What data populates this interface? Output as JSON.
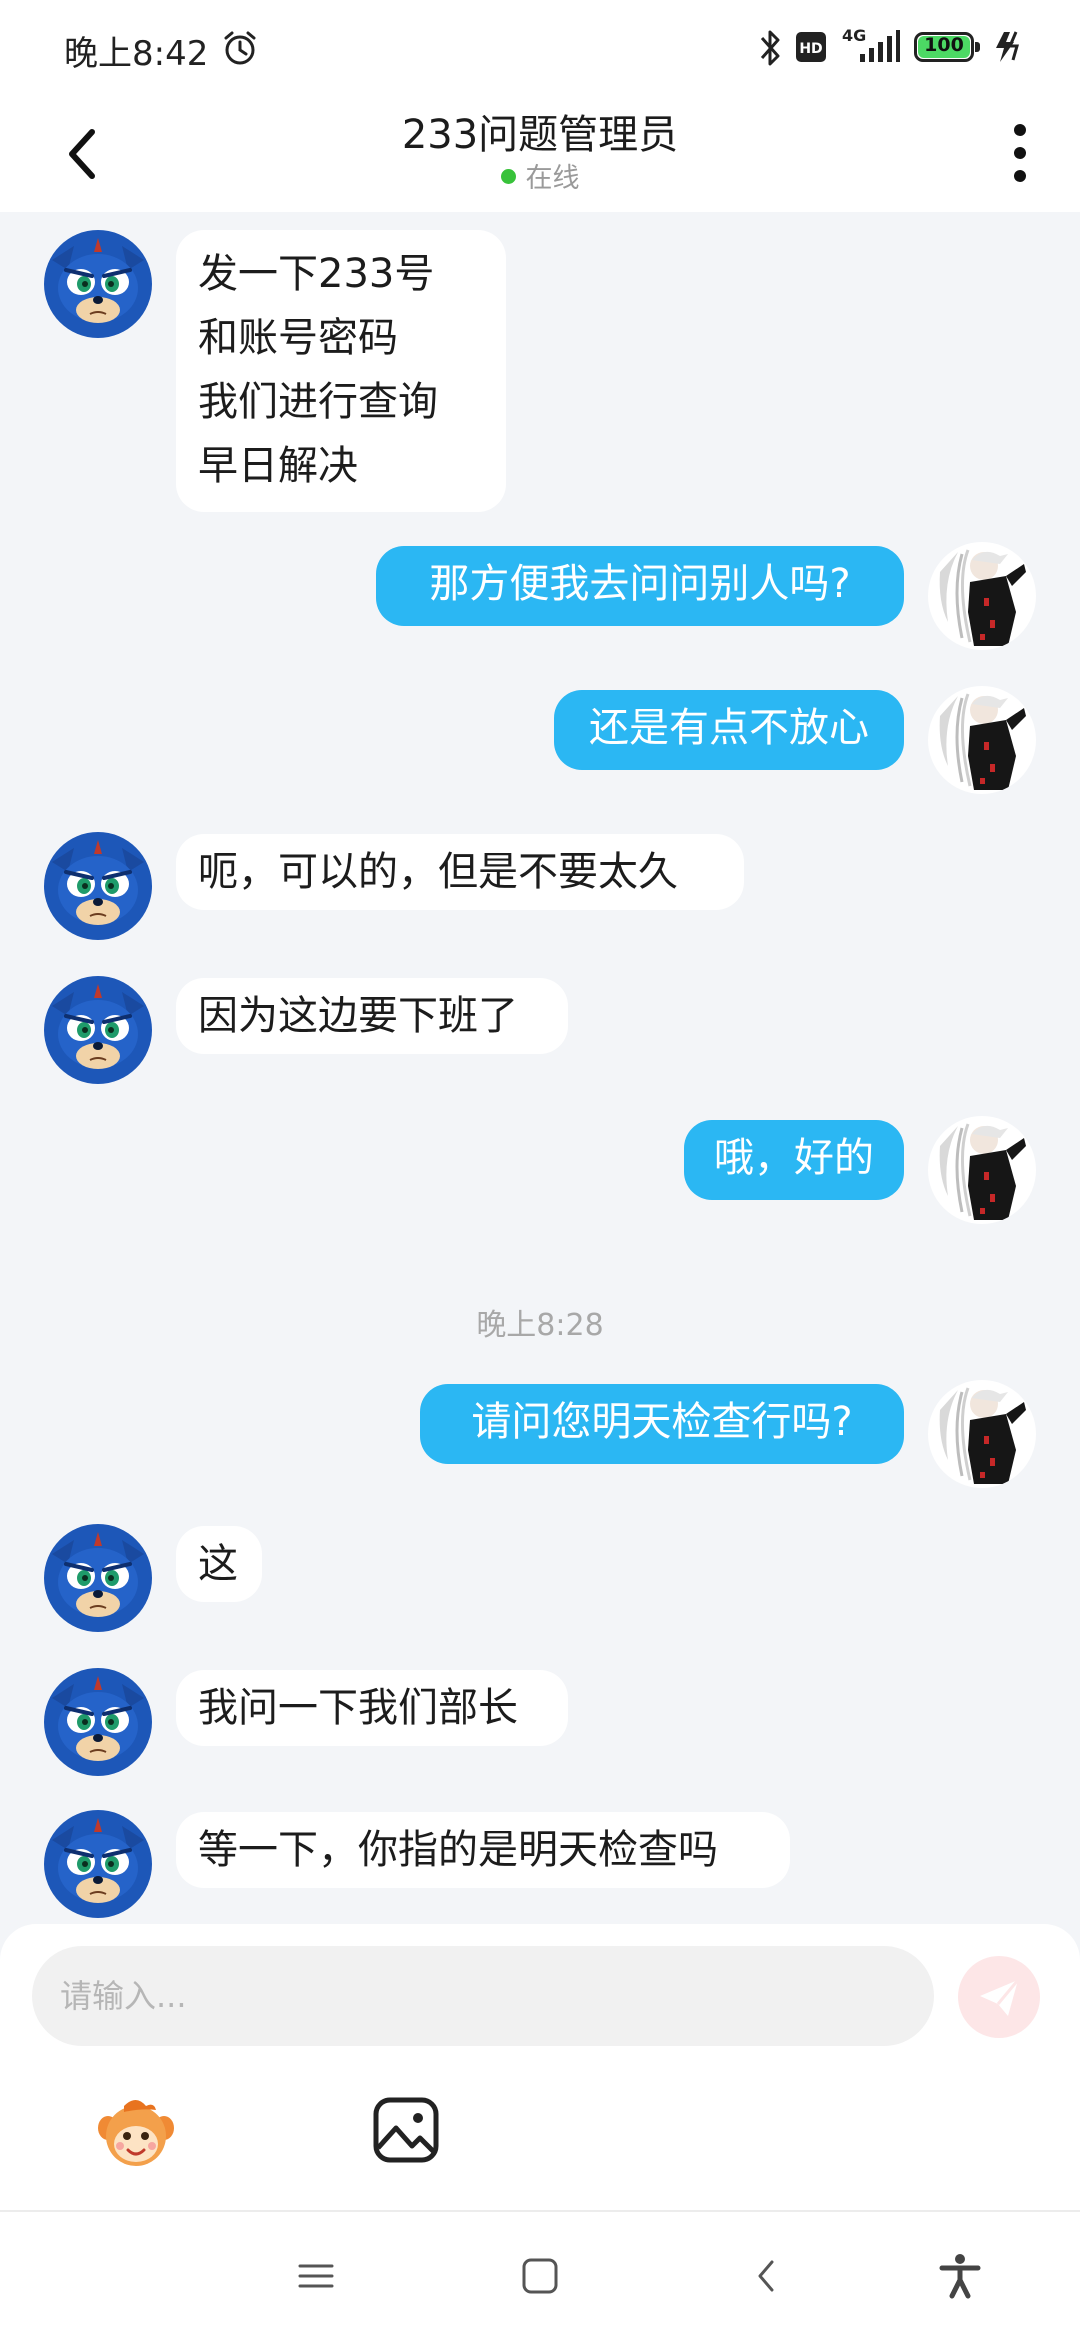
{
  "status_bar": {
    "time": "晚上8:42",
    "network": "4G",
    "battery": "100",
    "icons": [
      "alarm-icon",
      "bluetooth-icon",
      "hd-icon",
      "signal-icon",
      "battery-icon",
      "charging-icon"
    ]
  },
  "header": {
    "title": "233问题管理员",
    "status": "在线",
    "status_color": "#38c23a"
  },
  "messages": [
    {
      "from": "other",
      "text": "发一下233号\n和账号密码\n我们进行查询\n早日解决"
    },
    {
      "from": "me",
      "text": "那方便我去问问别人吗?"
    },
    {
      "from": "me",
      "text": "还是有点不放心"
    },
    {
      "from": "other",
      "text": "呃，可以的，但是不要太久"
    },
    {
      "from": "other",
      "text": "因为这边要下班了"
    },
    {
      "from": "me",
      "text": "哦，好的"
    },
    {
      "timestamp": "晚上8:28"
    },
    {
      "from": "me",
      "text": "请问您明天检查行吗?"
    },
    {
      "from": "other",
      "text": "这"
    },
    {
      "from": "other",
      "text": "我问一下我们部长"
    },
    {
      "from": "other",
      "text": "等一下，你指的是明天检查吗"
    }
  ],
  "input": {
    "placeholder": "请输入..."
  },
  "colors": {
    "outgoing_bubble": "#2bb7f3",
    "incoming_bubble": "#ffffff",
    "background": "#f3f5f8"
  },
  "toolbar_icons": [
    "emoji-icon",
    "image-icon"
  ],
  "nav_icons": [
    "menu-icon",
    "home-icon",
    "back-icon",
    "accessibility-icon"
  ]
}
